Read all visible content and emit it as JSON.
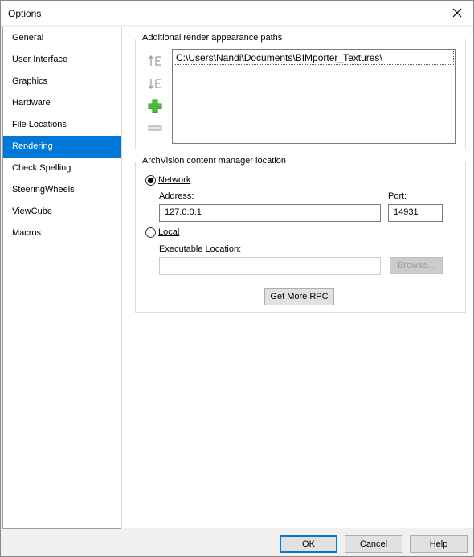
{
  "window": {
    "title": "Options"
  },
  "sidebar": {
    "items": [
      {
        "label": "General"
      },
      {
        "label": "User Interface"
      },
      {
        "label": "Graphics"
      },
      {
        "label": "Hardware"
      },
      {
        "label": "File Locations"
      },
      {
        "label": "Rendering",
        "selected": true
      },
      {
        "label": "Check Spelling"
      },
      {
        "label": "SteeringWheels"
      },
      {
        "label": "ViewCube"
      },
      {
        "label": "Macros"
      }
    ]
  },
  "render_paths": {
    "group_label": "Additional render appearance paths",
    "paths": [
      "C:\\Users\\Nandi\\Documents\\BIMporter_Textures\\"
    ],
    "icons": [
      "move-up-icon",
      "move-down-icon",
      "add-icon",
      "remove-icon"
    ]
  },
  "archvision": {
    "group_label": "ArchVision content manager location",
    "network_label": "Network",
    "network_selected": true,
    "address_label": "Address:",
    "address_value": "127.0.0.1",
    "port_label": "Port:",
    "port_value": "14931",
    "local_label": "Local",
    "local_selected": false,
    "exe_label": "Executable Location:",
    "exe_value": "",
    "browse_label": "Browse...",
    "get_rpc_label": "Get More RPC"
  },
  "footer": {
    "ok_label": "OK",
    "cancel_label": "Cancel",
    "help_label": "Help"
  },
  "colors": {
    "accent": "#0078d7",
    "add_icon": "#2e9e2e"
  }
}
